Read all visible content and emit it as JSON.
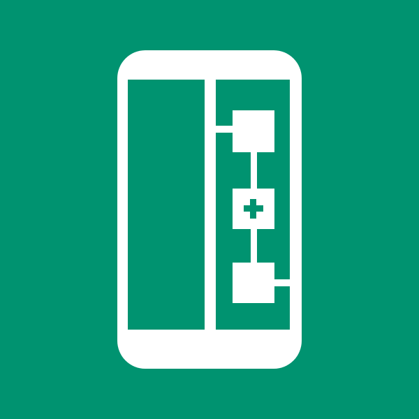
{
  "colors": {
    "background": "#009370",
    "foreground": "#ffffff"
  },
  "icon": {
    "name": "phone-flowchart-add-icon"
  }
}
